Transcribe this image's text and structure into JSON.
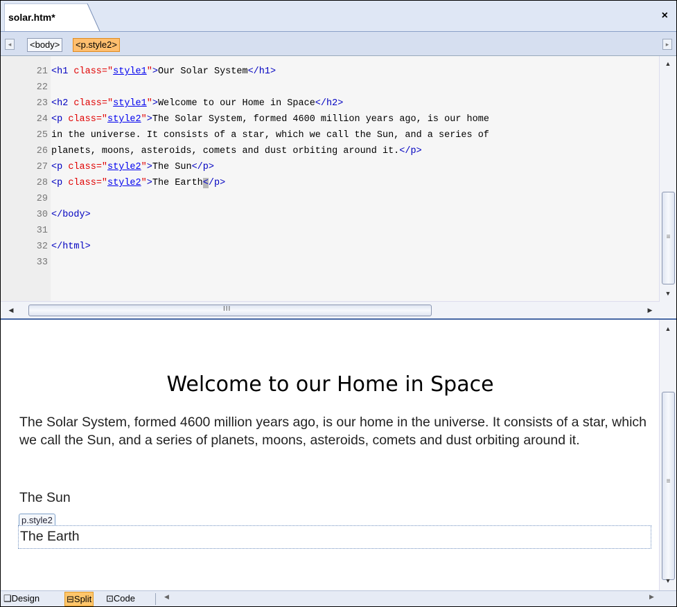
{
  "document_tab": {
    "title": "solar.htm*",
    "close_label": "×"
  },
  "tag_selector": {
    "tags": [
      "<body>",
      "<p.style2>"
    ],
    "left_arrow": "◂",
    "right_arrow": "▸"
  },
  "code_lines": [
    {
      "num": "21",
      "segments": [
        [
          "tg",
          "<h1 "
        ],
        [
          "at",
          "class=\""
        ],
        [
          "av",
          "style1"
        ],
        [
          "at",
          "\""
        ],
        [
          "tg",
          ">"
        ],
        [
          "tx",
          "Our Solar System"
        ],
        [
          "tg",
          "</h1>"
        ]
      ]
    },
    {
      "num": "22",
      "segments": []
    },
    {
      "num": "23",
      "segments": [
        [
          "tg",
          "<h2 "
        ],
        [
          "at",
          "class=\""
        ],
        [
          "av",
          "style1"
        ],
        [
          "at",
          "\""
        ],
        [
          "tg",
          ">"
        ],
        [
          "tx",
          "Welcome to our Home in Space"
        ],
        [
          "tg",
          "</h2>"
        ]
      ]
    },
    {
      "num": "24",
      "segments": [
        [
          "tg",
          "<p "
        ],
        [
          "at",
          "class=\""
        ],
        [
          "av",
          "style2"
        ],
        [
          "at",
          "\""
        ],
        [
          "tg",
          ">"
        ],
        [
          "tx",
          "The Solar System, formed 4600 million years ago, is our home"
        ]
      ]
    },
    {
      "num": "25",
      "segments": [
        [
          "tx",
          "in the universe. It consists of a star, which we call the Sun, and a series of"
        ]
      ]
    },
    {
      "num": "26",
      "segments": [
        [
          "tx",
          "planets, moons, asteroids, comets and dust orbiting around it."
        ],
        [
          "tg",
          "</p>"
        ]
      ]
    },
    {
      "num": "27",
      "segments": [
        [
          "tg",
          "<p "
        ],
        [
          "at",
          "class=\""
        ],
        [
          "av",
          "style2"
        ],
        [
          "at",
          "\""
        ],
        [
          "tg",
          ">"
        ],
        [
          "tx",
          "The Sun"
        ],
        [
          "tg",
          "</p>"
        ]
      ]
    },
    {
      "num": "28",
      "segments": [
        [
          "tg",
          "<p "
        ],
        [
          "at",
          "class=\""
        ],
        [
          "av",
          "style2"
        ],
        [
          "at",
          "\""
        ],
        [
          "tg",
          ">"
        ],
        [
          "tx",
          "The Earth"
        ],
        [
          "cur",
          "<"
        ],
        [
          "tg",
          "/p>"
        ]
      ]
    },
    {
      "num": "29",
      "segments": []
    },
    {
      "num": "30",
      "segments": [
        [
          "tg",
          "</body>"
        ]
      ]
    },
    {
      "num": "31",
      "segments": []
    },
    {
      "num": "32",
      "segments": [
        [
          "tg",
          "</html>"
        ]
      ]
    },
    {
      "num": "33",
      "segments": []
    }
  ],
  "design_view": {
    "heading": "Welcome to our Home in Space",
    "paragraph": "The Solar System, formed 4600 million years ago, is our home in the universe. It consists of a star, which we call the Sun, and a series of planets, moons, asteroids, comets and dust orbiting around it.",
    "sun": "The Sun",
    "selected_tag_label": "p.style2",
    "earth": "The Earth"
  },
  "view_buttons": {
    "design": "Design",
    "split": "Split",
    "code": "Code",
    "active": "Split"
  },
  "scrollbar": {
    "h_grip": "III",
    "up": "▲",
    "down": "▼",
    "left": "◀",
    "right": "▶"
  },
  "colors": {
    "tag": "#0000c0",
    "attribute": "#e00000",
    "attribute_value": "#0000ee",
    "selected_tag": "#ffbe6e",
    "splitter": "#4667a4"
  }
}
